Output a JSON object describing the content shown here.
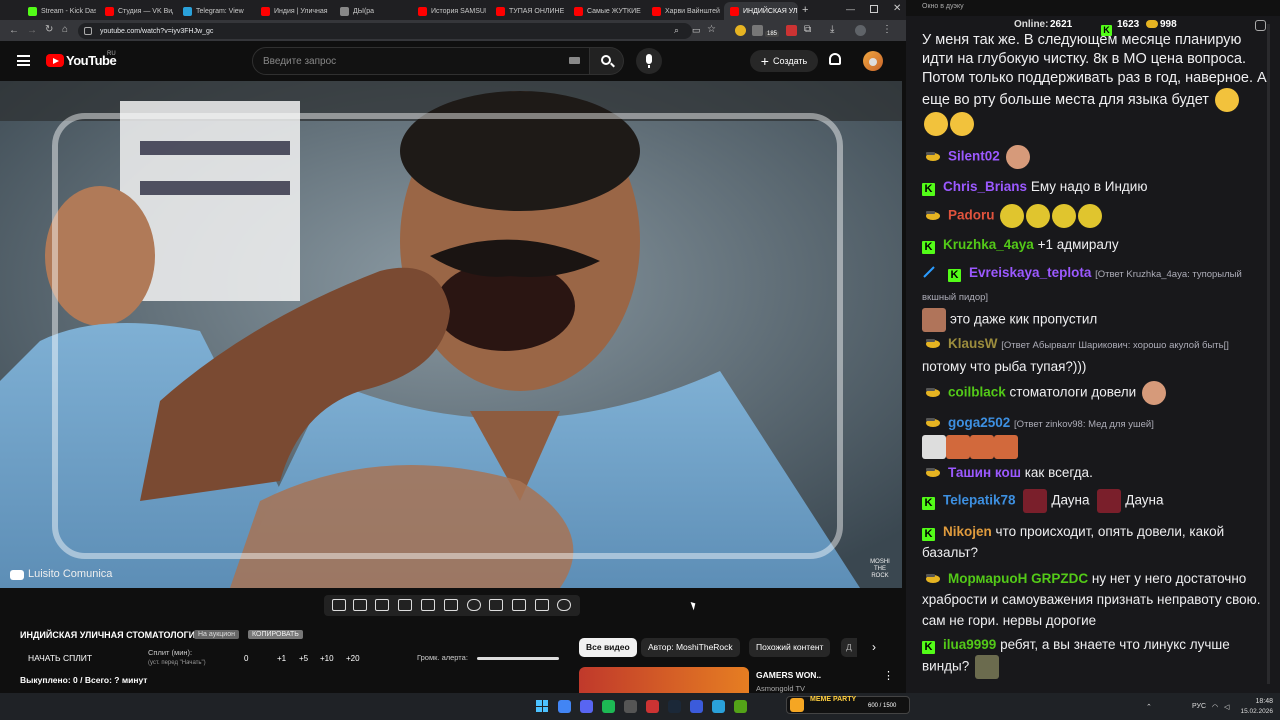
{
  "browser": {
    "tabs": [
      {
        "label": "Stream - Kick Dash",
        "color": "#53fc18"
      },
      {
        "label": "Студия — VK Видео",
        "color": "#ff0000"
      },
      {
        "label": "Telegram: View",
        "color": "#2aa1da"
      },
      {
        "label": "Индия | Уличная",
        "color": "#ff0000"
      },
      {
        "label": "ДЫ(ра",
        "color": "#888888"
      },
      {
        "label": "История SAMSUNG",
        "color": "#ff0000"
      },
      {
        "label": "ТУПАЯ ОНЛИНЕ",
        "color": "#ff0000"
      },
      {
        "label": "Самые ЖУТКИЕ",
        "color": "#ff0000"
      },
      {
        "label": "Харви Вайнштейн",
        "color": "#ff0000"
      },
      {
        "label": "ИНДИЙСКАЯ УЛИЧНАЯ",
        "color": "#ff0000",
        "active": true
      }
    ],
    "url": "youtube.com/watch?v=iyv3FHJw_gc",
    "ext_badge": "185"
  },
  "youtube": {
    "logo": "YouTube",
    "region": "RU",
    "search_placeholder": "Введите запрос",
    "create_label": "Создать",
    "video_watermark": "Luisito Comunica",
    "video_corner_tag": "MOSHI THE ROCK",
    "filter_chips": [
      "Все видео",
      "Автор: MoshiTheRock",
      "Похожий контент",
      "Д"
    ],
    "rec_title": "GAMERS WON..",
    "rec_channel": "Asmongold TV"
  },
  "overlay": {
    "title": "ИНДИЙСКАЯ УЛИЧНАЯ СТОМАТОЛОГИЯ",
    "badge_auction": "На аукцион",
    "badge_copy": "КОПИРОВАТЬ",
    "start_split": "НАЧАТЬ СПЛИТ",
    "split_label": "Сплит (мин):",
    "split_hint": "(уст. перед \"Начать\")",
    "split_value": "0",
    "increments": [
      "+1",
      "+5",
      "+10",
      "+20"
    ],
    "alert_volume_label": "Громк. алерта:",
    "bought": "Выкуплено: 0 / Всего: ? минут"
  },
  "chat": {
    "online_label": "Online:",
    "online_count": "2621",
    "followers": "1623",
    "coins": "998",
    "window_title": "Окно в дуэку",
    "intro_text": "У меня так же. В следующем месяце планирую идти на глубокую чистку. 8к в МО цена вопроса. Потом только поддерживать раз в год, наверное. А еще во рту больше места для языка будет",
    "messages": [
      {
        "nick": "Silent02",
        "color": "#9b59ff",
        "badge": "twitch",
        "text": ""
      },
      {
        "nick": "Chris_Brians",
        "color": "#9b59ff",
        "badge": "kick",
        "text": "Ему надо в Индию"
      },
      {
        "nick": "Padoru",
        "color": "#e0533d",
        "badge": "twitch",
        "text": ""
      },
      {
        "nick": "Kruzhka_4aya",
        "color": "#53c918",
        "badge": "kick",
        "text": "+1 адмиралу"
      },
      {
        "nick": "Evreiskaya_teplota",
        "color": "#9b59ff",
        "badge": "kick",
        "reply": "[Ответ Kruzhka_4aya: тупорылый вкшный пидор]",
        "text": "это даже кик пропустил"
      },
      {
        "nick": "KlausW",
        "color": "#9b8c3d",
        "badge": "twitch",
        "reply": "[Ответ Абырвалг Шарикович: хорошо акулой быть[]",
        "text": "потому что рыба тупая?)))"
      },
      {
        "nick": "coilblack",
        "color": "#53c918",
        "badge": "twitch",
        "text": "стоматологи довели"
      },
      {
        "nick": "goga2502",
        "color": "#3d8fe0",
        "badge": "twitch",
        "reply": "[Ответ zinkov98: Мед для ушей]",
        "text": ""
      },
      {
        "nick": "Ташин кош",
        "color": "#9b59ff",
        "badge": "twitch",
        "text": "как всегда."
      },
      {
        "nick": "Telepatik78",
        "color": "#3d8fe0",
        "badge": "kick",
        "text": "Дауна",
        "text2": "Дауна"
      },
      {
        "nick": "Nikojen",
        "color": "#e09b3d",
        "badge": "kick",
        "text": "что происходит, опять довели, какой базальт?"
      },
      {
        "nick": "МормарuoH",
        "color": "#53c918",
        "badge": "twitch",
        "nick2": "GRPZDC",
        "text": "ну нет у него достаточно храбрости и самоуважения признать неправоту свою. сам не гори. нервы дорогие"
      },
      {
        "nick": "ilua9999",
        "color": "#53c918",
        "badge": "kick",
        "text": "ребят, а вы знаете что линукс лучше винды?"
      }
    ]
  },
  "taskbar": {
    "media_label": "MEME PARTY",
    "media_progress": "600 / 1500",
    "lang": "РУС",
    "time": "18:48",
    "date": "15.02.2026"
  }
}
